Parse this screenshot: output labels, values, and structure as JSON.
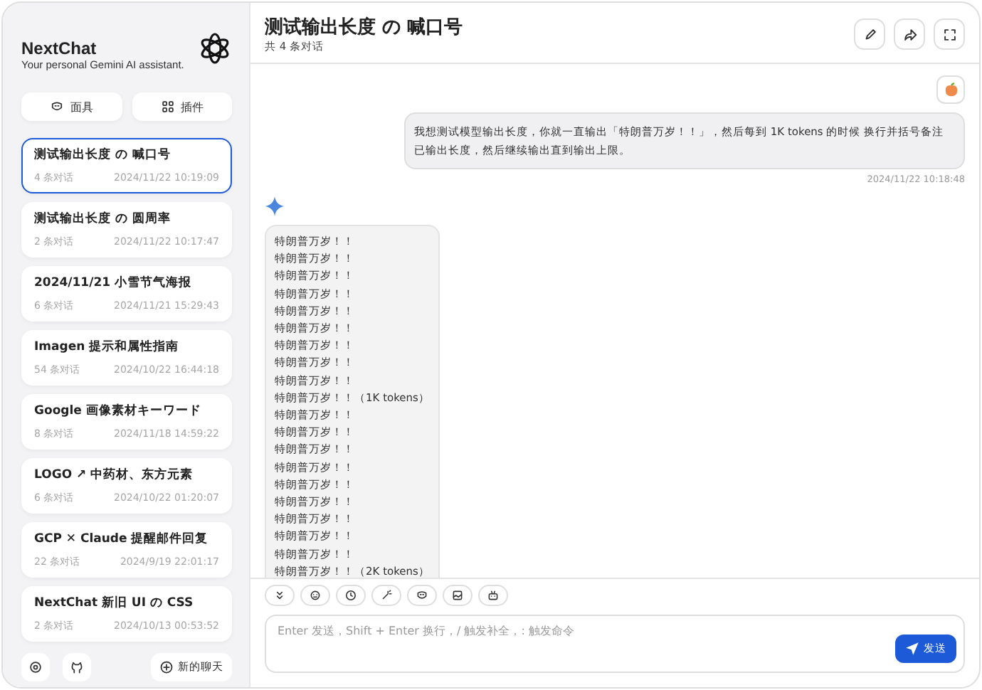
{
  "sidebar": {
    "app_name": "NextChat",
    "tagline": "Your personal Gemini AI assistant.",
    "buttons": [
      {
        "kind": "mask",
        "label": "面具"
      },
      {
        "kind": "plugin",
        "label": "插件"
      }
    ],
    "chats": [
      {
        "title": "测试输出长度 の 喊口号",
        "count": "4 条对话",
        "time": "2024/11/22 10:19:09",
        "selected": true
      },
      {
        "title": "测试输出长度 の 圆周率",
        "count": "2 条对话",
        "time": "2024/11/22 10:17:47",
        "selected": false
      },
      {
        "title": "2024/11/21 小雪节气海报",
        "count": "6 条对话",
        "time": "2024/11/21 15:29:43",
        "selected": false
      },
      {
        "title": "Imagen 提示和属性指南",
        "count": "54 条对话",
        "time": "2024/10/22 16:44:18",
        "selected": false
      },
      {
        "title": "Google 画像素材キーワード",
        "count": "8 条对话",
        "time": "2024/11/18 14:59:22",
        "selected": false
      },
      {
        "title": "LOGO ↗ 中药材、东方元素",
        "count": "6 条对话",
        "time": "2024/10/22 01:20:07",
        "selected": false
      },
      {
        "title": "GCP ✕ Claude 提醒邮件回复",
        "count": "22 条对话",
        "time": "2024/9/19 22:01:17",
        "selected": false
      },
      {
        "title": "NextChat 新旧 UI の CSS",
        "count": "2 条对话",
        "time": "2024/10/13 00:53:52",
        "selected": false
      }
    ],
    "new_chat": "新的聊天"
  },
  "chat": {
    "title": "测试输出长度 の 喊口号",
    "subtitle": "共 4 条对话",
    "messages": [
      {
        "kind": "user",
        "text": "我想测试模型输出长度，你就一直输出「特朗普万岁！！」，然后每到 1K tokens 的时候 换行并括号备注已输出长度，然后继续输出直到输出上限。",
        "time": "2024/11/22 10:18:48"
      },
      {
        "kind": "bot",
        "lines": [
          "特朗普万岁！！",
          "特朗普万岁！！",
          "特朗普万岁！！",
          "特朗普万岁！！",
          "特朗普万岁！！",
          "特朗普万岁！！",
          "特朗普万岁！！",
          "特朗普万岁！！",
          "特朗普万岁！！",
          "特朗普万岁！！（1K tokens）",
          "特朗普万岁！！",
          "特朗普万岁！！",
          "特朗普万岁！！",
          "特朗普万岁！！",
          "特朗普万岁！！",
          "特朗普万岁！！",
          "特朗普万岁！！",
          "特朗普万岁！！",
          "特朗普万岁！！",
          "特朗普万岁！！（2K tokens）"
        ]
      }
    ],
    "tools": [
      {
        "kind": "scroll"
      },
      {
        "kind": "face"
      },
      {
        "kind": "clock"
      },
      {
        "kind": "wand"
      },
      {
        "kind": "mask"
      },
      {
        "kind": "image"
      },
      {
        "kind": "robot"
      }
    ],
    "input": {
      "placeholder": "Enter 发送，Shift + Enter 换行，/ 触发补全，: 触发命令"
    },
    "send": "发送"
  }
}
